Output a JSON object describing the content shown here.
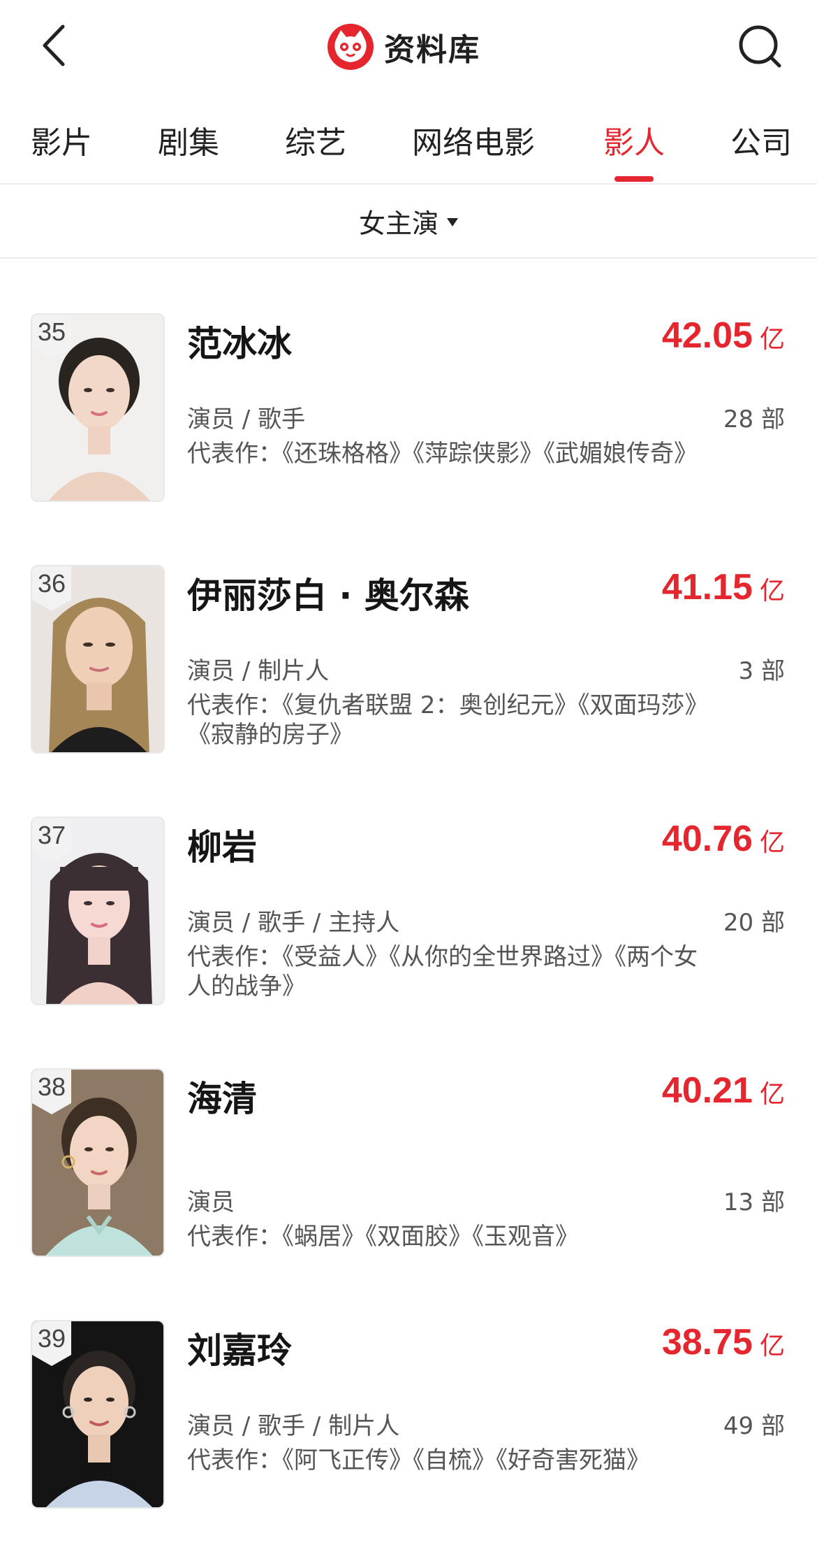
{
  "header": {
    "title": "资料库",
    "back_icon": "chevron-left-icon",
    "search_icon": "search-icon",
    "logo_icon": "cat-logo-icon",
    "brand_color": "#e5262f"
  },
  "tabs": [
    {
      "label": "影片",
      "active": false
    },
    {
      "label": "剧集",
      "active": false
    },
    {
      "label": "综艺",
      "active": false
    },
    {
      "label": "网络电影",
      "active": false
    },
    {
      "label": "影人",
      "active": true
    },
    {
      "label": "公司",
      "active": false
    }
  ],
  "filter": {
    "label": "女主演"
  },
  "people": [
    {
      "rank": "35",
      "name": "范冰冰",
      "box_value": "42.05",
      "box_unit": "亿",
      "roles": "演员 / 歌手",
      "count": "28 部",
      "works": "代表作：《还珠格格》《萍踪侠影》《武媚娘传奇》"
    },
    {
      "rank": "36",
      "name": "伊丽莎白 · 奥尔森",
      "box_value": "41.15",
      "box_unit": "亿",
      "roles": "演员 / 制片人",
      "count": "3 部",
      "works": "代表作：《复仇者联盟 2：奥创纪元》《双面玛莎》《寂静的房子》"
    },
    {
      "rank": "37",
      "name": "柳岩",
      "box_value": "40.76",
      "box_unit": "亿",
      "roles": "演员 / 歌手 / 主持人",
      "count": "20 部",
      "works": "代表作：《受益人》《从你的全世界路过》《两个女人的战争》"
    },
    {
      "rank": "38",
      "name": "海清",
      "box_value": "40.21",
      "box_unit": "亿",
      "roles": "演员",
      "count": "13 部",
      "works": "代表作：《蜗居》《双面胶》《玉观音》"
    },
    {
      "rank": "39",
      "name": "刘嘉玲",
      "box_value": "38.75",
      "box_unit": "亿",
      "roles": "演员 / 歌手 / 制片人",
      "count": "49 部",
      "works": "代表作：《阿飞正传》《自梳》《好奇害死猫》"
    }
  ]
}
